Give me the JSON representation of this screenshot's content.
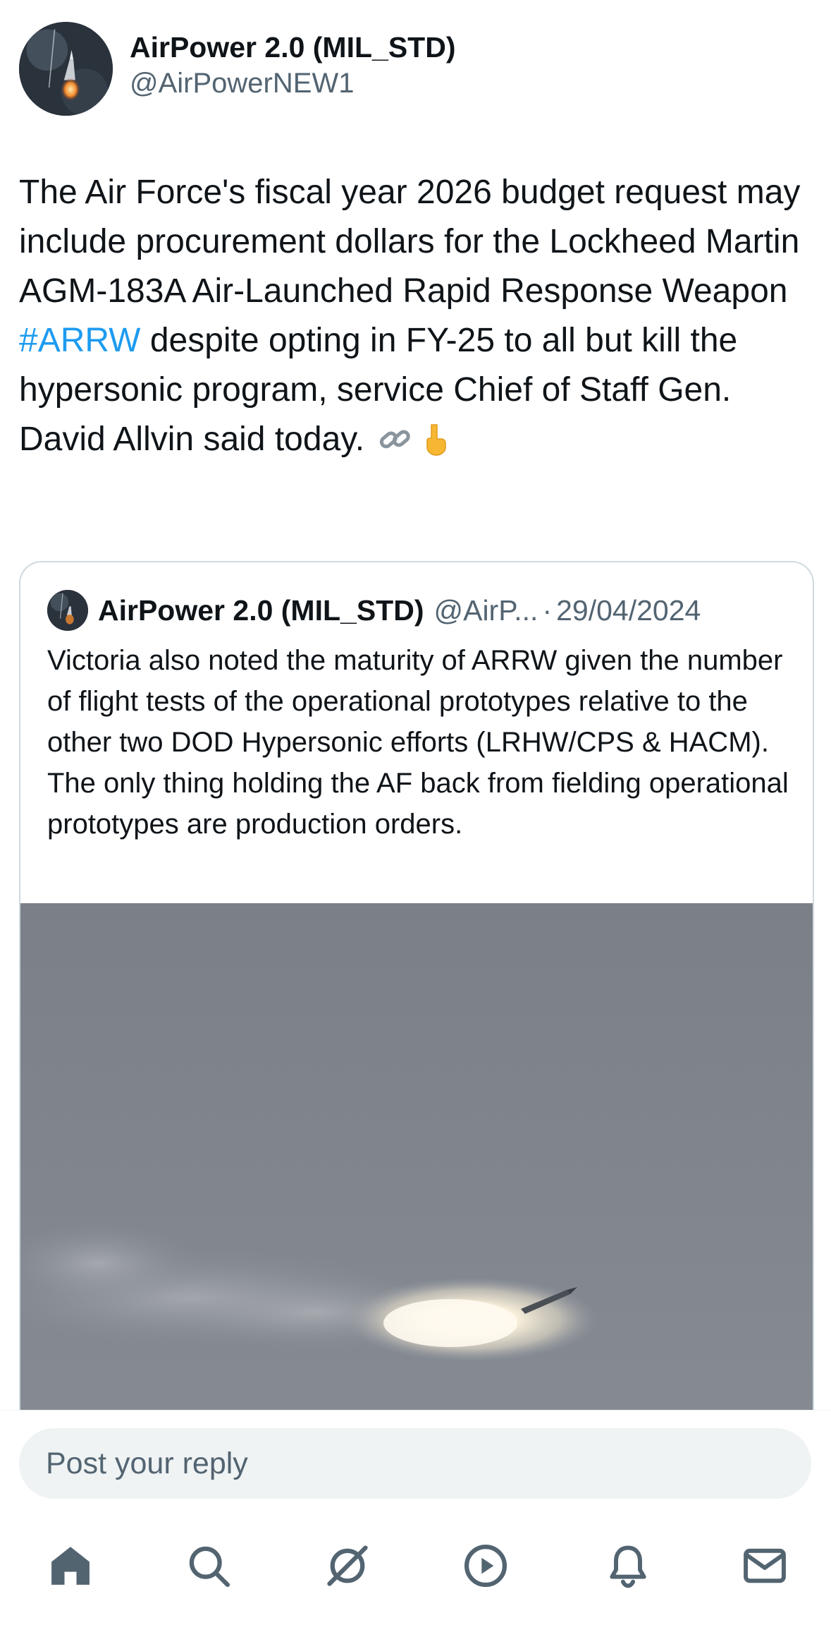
{
  "post": {
    "author": {
      "display_name": "AirPower 2.0 (MIL_STD)",
      "handle": "@AirPowerNEW1"
    },
    "text_before": "The Air Force's fiscal year 2026 budget request may include procurement dollars for the Lockheed Martin AGM-183A Air-Launched Rapid Response Weapon ",
    "hashtag": "#ARRW",
    "text_after": " despite opting in FY-25 to all but kill the hypersonic program, service Chief of Staff Gen. David Allvin said today.",
    "emojis": [
      "link-emoji",
      "pointing-down-emoji"
    ]
  },
  "quote": {
    "display_name": "AirPower 2.0 (MIL_STD)",
    "handle": "@AirP...",
    "separator": "·",
    "date": "29/04/2024",
    "text": "Victoria also noted the maturity of ARRW given the number of flight tests of the operational prototypes relative to the other two DOD Hypersonic efforts (LRHW/CPS & HACM). The only thing holding the AF back from fielding operational prototypes are production orders."
  },
  "reply": {
    "placeholder": "Post your reply"
  },
  "nav": {
    "items": [
      "home-icon",
      "search-icon",
      "grok-icon",
      "video-icon",
      "notifications-icon",
      "messages-icon"
    ]
  },
  "colors": {
    "text": "#0f1419",
    "secondary": "#536471",
    "link": "#1d9bf0",
    "border": "#cfd9de",
    "reply_bg": "#eff3f4"
  }
}
